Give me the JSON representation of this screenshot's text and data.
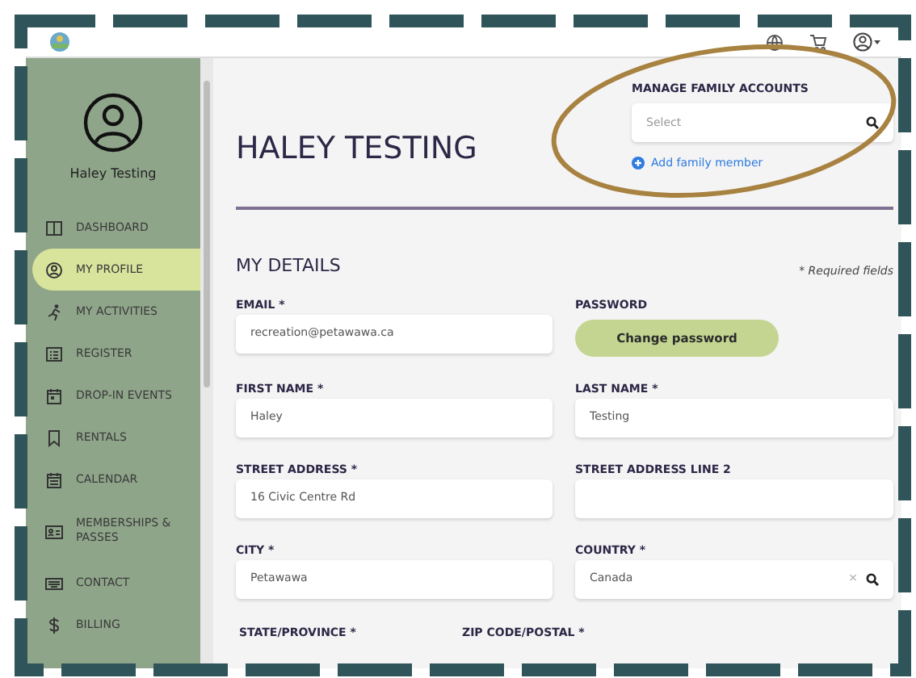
{
  "sidebar": {
    "user_name": "Haley Testing",
    "items": [
      {
        "label": "DASHBOARD",
        "selected": false
      },
      {
        "label": "MY PROFILE",
        "selected": true
      },
      {
        "label": "MY ACTIVITIES",
        "selected": false
      },
      {
        "label": "REGISTER",
        "selected": false
      },
      {
        "label": "DROP-IN EVENTS",
        "selected": false
      },
      {
        "label": "RENTALS",
        "selected": false
      },
      {
        "label": "CALENDAR",
        "selected": false
      },
      {
        "label": "MEMBERSHIPS & PASSES",
        "selected": false
      },
      {
        "label": "CONTACT",
        "selected": false
      },
      {
        "label": "BILLING",
        "selected": false
      }
    ]
  },
  "page": {
    "title": "HALEY TESTING",
    "family": {
      "label": "MANAGE FAMILY ACCOUNTS",
      "placeholder": "Select",
      "link": "Add family member"
    },
    "section_title": "MY DETAILS",
    "required_note": "* Required fields",
    "fields": [
      {
        "kind": "input",
        "label": "EMAIL *",
        "value": "recreation@petawawa.ca"
      },
      {
        "kind": "button",
        "label": "PASSWORD",
        "button": "Change password"
      },
      {
        "kind": "input",
        "label": "FIRST NAME *",
        "value": "Haley"
      },
      {
        "kind": "input",
        "label": "LAST NAME *",
        "value": "Testing"
      },
      {
        "kind": "input",
        "label": "STREET ADDRESS *",
        "value": "16 Civic Centre Rd"
      },
      {
        "kind": "input",
        "label": "STREET ADDRESS LINE 2"
      },
      {
        "kind": "input",
        "label": "CITY *",
        "value": "Petawawa"
      },
      {
        "kind": "select",
        "label": "COUNTRY *",
        "value": "Canada",
        "clear": "×"
      }
    ],
    "bottom_labels": [
      "STATE/PROVINCE *",
      "ZIP CODE/POSTAL *"
    ]
  }
}
